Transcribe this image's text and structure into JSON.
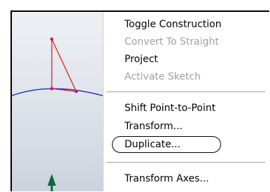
{
  "menu": {
    "items": [
      {
        "label": "Toggle Construction",
        "enabled": true
      },
      {
        "label": "Convert To Straight",
        "enabled": false
      },
      {
        "label": "Project",
        "enabled": true
      },
      {
        "label": "Activate Sketch",
        "enabled": false
      },
      {
        "label": "Shift Point-to-Point",
        "enabled": true
      },
      {
        "label": "Transform...",
        "enabled": true
      },
      {
        "label": "Duplicate...",
        "enabled": true,
        "highlighted": true
      },
      {
        "label": "Transform Axes...",
        "enabled": true
      }
    ]
  },
  "colors": {
    "sketch_lines": "#e0201e",
    "sketch_points": "#c0186e",
    "arc": "#1020c0",
    "axis_marker": "#0b6b3a",
    "disabled_text": "#a0a0a0"
  }
}
